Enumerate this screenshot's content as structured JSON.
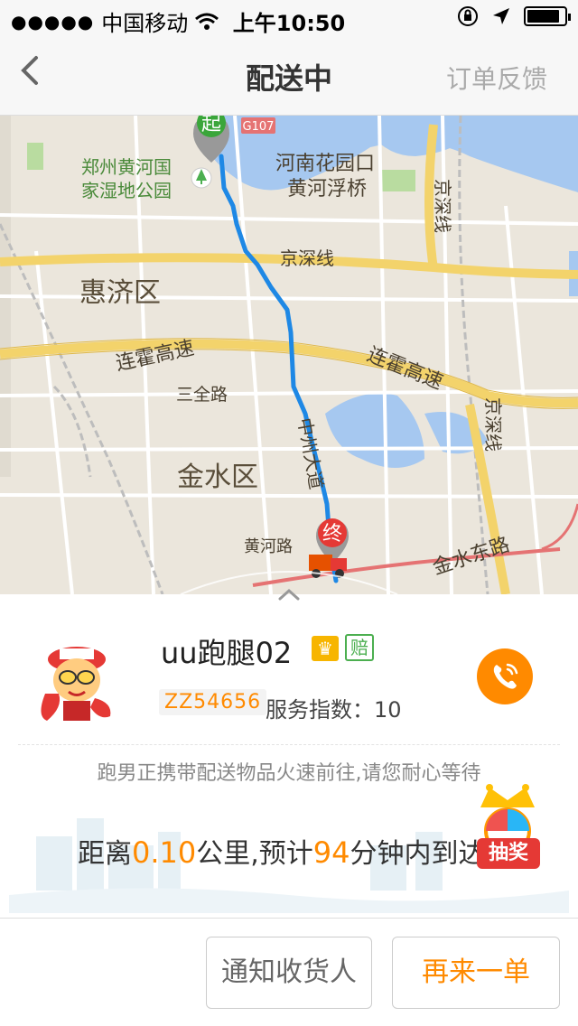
{
  "status_bar": {
    "carrier": "中国移动",
    "time": "上午10:50"
  },
  "nav": {
    "title": "配送中",
    "feedback_label": "订单反馈"
  },
  "map": {
    "start_marker": "起",
    "end_marker": "终",
    "labels": {
      "g107": "G107",
      "wetland_park_line1": "郑州黄河国",
      "wetland_park_line2": "家湿地公园",
      "bridge_line1": "河南花园口",
      "bridge_line2": "黄河浮桥",
      "jingshen_vertical_top": "京深线",
      "jingshen_horizontal": "京深线",
      "huiji": "惠济区",
      "lianhuo_left": "连霍高速",
      "lianhuo_right": "连霍高速",
      "sanquan": "三全路",
      "jingshen_vertical_right": "京深线",
      "zhongzhou": "中州大道",
      "jinshui": "金水区",
      "huanghe_road": "黄河路",
      "jinshui_east": "金水东路"
    },
    "colors": {
      "route": "#1e88e5",
      "river": "#a6c8f0",
      "highway": "#f3d36b",
      "park": "#b9dca0"
    }
  },
  "courier": {
    "name": "uu跑腿02",
    "vip_icon": "crown-icon",
    "compensate_badge": "赔",
    "code": "ZZ54656",
    "service_index_label": "服务指数：",
    "service_index_value": "10"
  },
  "delivery": {
    "hint": "跑男正携带配送物品火速前往,请您耐心等待",
    "eta_prefix": "距离",
    "distance": "0.10",
    "eta_mid": "公里,预计",
    "minutes": "94",
    "eta_suffix": "分钟内到达",
    "lottery_label": "抽奖"
  },
  "actions": {
    "notify_label": "通知收货人",
    "reorder_label": "再来一单"
  },
  "accent_color": "#ff8a00"
}
